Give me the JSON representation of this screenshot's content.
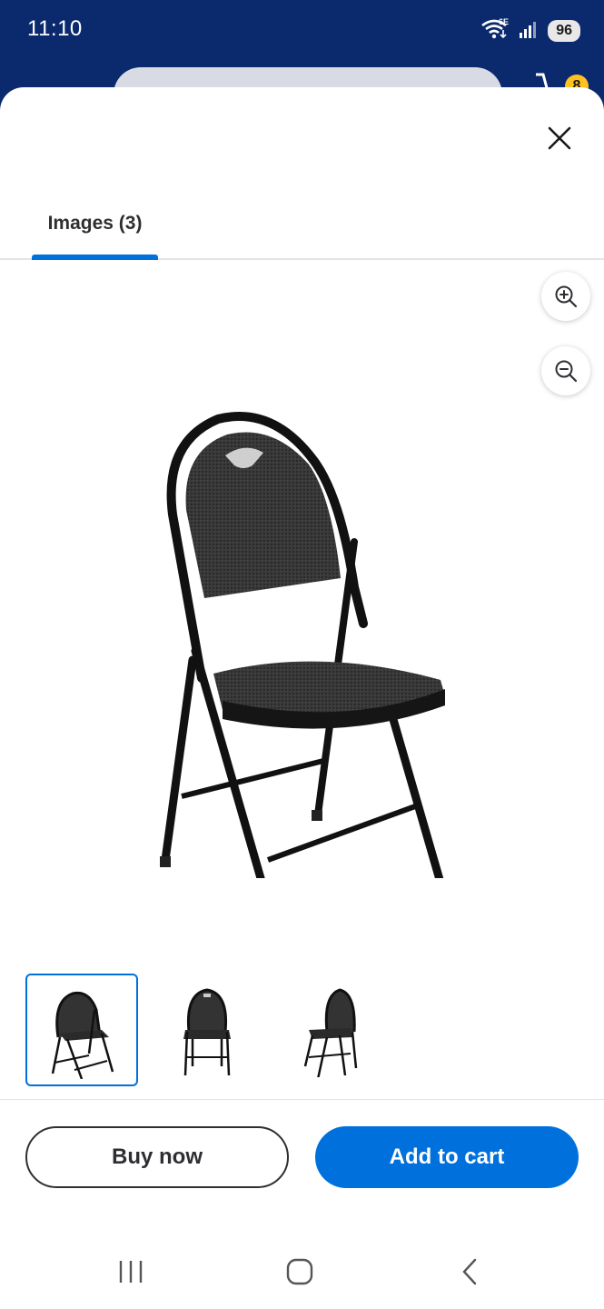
{
  "status_bar": {
    "time": "11:10",
    "network_label": "6E",
    "battery": "96"
  },
  "background_header": {
    "cart_count": "8"
  },
  "modal": {
    "close_icon": "close-icon",
    "tabs": [
      {
        "label": "Images (3)",
        "selected": true
      }
    ],
    "zoom_in_icon": "zoom-in-icon",
    "zoom_out_icon": "zoom-out-icon",
    "main_image": "folding-chair-front-angle",
    "thumbnails": [
      {
        "image": "folding-chair-angle",
        "selected": true
      },
      {
        "image": "folding-chair-front",
        "selected": false
      },
      {
        "image": "folding-chair-side",
        "selected": false
      }
    ],
    "actions": {
      "buy_now": "Buy now",
      "add_to_cart": "Add to cart"
    }
  },
  "nav_bar": {
    "recents_icon": "recents-icon",
    "home_icon": "home-icon",
    "back_icon": "back-icon"
  },
  "colors": {
    "header_bg": "#0b2a6e",
    "accent": "#0071dc",
    "text_primary": "#2e2f32",
    "badge": "#ffc220"
  }
}
